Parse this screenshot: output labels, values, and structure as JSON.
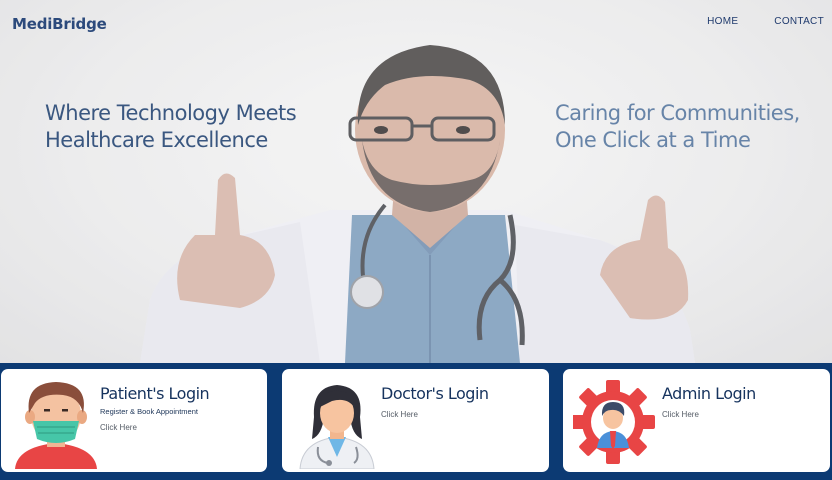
{
  "brand": "MediBridge",
  "nav": {
    "home": "HOME",
    "contact": "CONTACT"
  },
  "hero": {
    "tagline_left": "Where Technology Meets Healthcare Excellence",
    "tagline_right": "Caring for Communities, One Click at a Time"
  },
  "cards": {
    "patient": {
      "title": "Patient's Login",
      "subtitle": "Register & Book Appointment",
      "link": "Click Here"
    },
    "doctor": {
      "title": "Doctor's Login",
      "link": "Click Here"
    },
    "admin": {
      "title": "Admin Login",
      "link": "Click Here"
    }
  },
  "colors": {
    "brand_blue": "#2c4a7c",
    "band_navy": "#0c3a73",
    "card_white": "#ffffff",
    "gear_red": "#e84545"
  },
  "icons": [
    "doctor-hero-photo",
    "patient-mask-icon",
    "doctor-female-icon",
    "admin-gear-icon"
  ]
}
